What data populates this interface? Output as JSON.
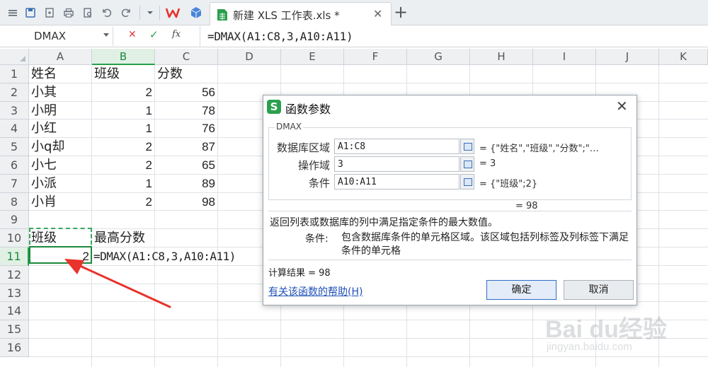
{
  "app": {
    "tab_title": "新建 XLS 工作表.xls *",
    "new_tab_symbol": "+",
    "close_symbol": "✕"
  },
  "formula_bar": {
    "name_box": "DMAX",
    "cancel_symbol": "✕",
    "accept_symbol": "✓",
    "fx_label": "fx",
    "formula": "=DMAX(A1:C8,3,A10:A11)"
  },
  "columns": [
    "A",
    "B",
    "C",
    "D",
    "E",
    "F",
    "G",
    "H",
    "I",
    "J",
    "K"
  ],
  "rows": [
    "1",
    "2",
    "3",
    "4",
    "5",
    "6",
    "7",
    "8",
    "9",
    "10",
    "11",
    "12",
    "13",
    "14",
    "15",
    "16"
  ],
  "cells": {
    "A1": "姓名",
    "B1": "班级",
    "C1": "分数",
    "A2": "小其",
    "B2": "2",
    "C2": "56",
    "A3": "小明",
    "B3": "1",
    "C3": "78",
    "A4": "小红",
    "B4": "1",
    "C4": "76",
    "A5": "小q却",
    "B5": "2",
    "C5": "87",
    "A6": "小七",
    "B6": "2",
    "C6": "65",
    "A7": "小派",
    "B7": "1",
    "C7": "89",
    "A8": "小肖",
    "B8": "2",
    "C8": "98",
    "A10": "班级",
    "B10": "最高分数",
    "A11": "2",
    "B11": "=DMAX(A1:C8,3,A10:A11)"
  },
  "dialog": {
    "title": "函数参数",
    "logo_letter": "S",
    "close_symbol": "✕",
    "group_label": "DMAX",
    "args": [
      {
        "label": "数据库区域",
        "value": "A1:C8",
        "result": "= {\"姓名\",\"班级\",\"分数\";\"…"
      },
      {
        "label": "操作域",
        "value": "3",
        "result": "= 3"
      },
      {
        "label": "条件",
        "value": "A10:A11",
        "result": "= {\"班级\";2}"
      }
    ],
    "inline_result": "= 98",
    "description": "返回列表或数据库的列中满足指定条件的最大数值。",
    "param_name": "条件:",
    "param_desc": "包含数据库条件的单元格区域。该区域包括列标签及列标签下满足条件的单元格",
    "calc_result": "计算结果 = 98",
    "help_link": "有关该函数的帮助(H)",
    "ok_label": "确定",
    "cancel_label": "取消"
  },
  "watermark": {
    "brand": "Bai du经验",
    "url": "jingyan.baidu.com"
  },
  "colors": {
    "accent_green": "#23a04a",
    "annotation_red": "#e8322b",
    "link_blue": "#1f4fb8"
  }
}
